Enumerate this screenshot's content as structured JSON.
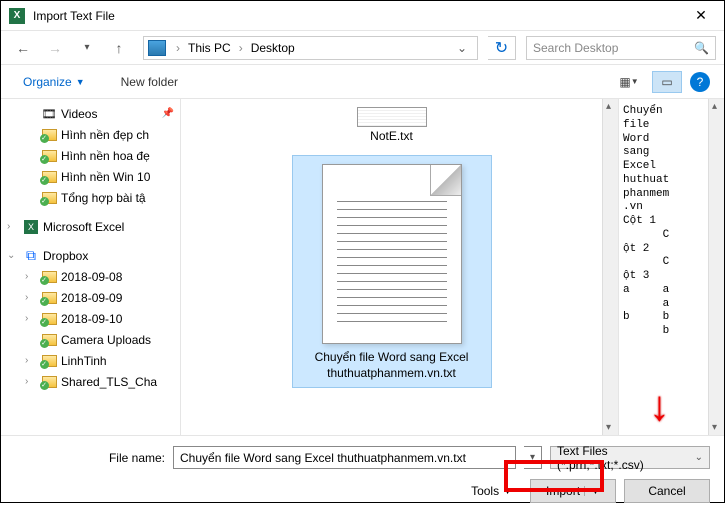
{
  "title": "Import Text File",
  "breadcrumb": {
    "loc1": "This PC",
    "loc2": "Desktop"
  },
  "search": {
    "placeholder": "Search Desktop"
  },
  "toolbar": {
    "organize": "Organize",
    "newfolder": "New folder"
  },
  "tree": {
    "videos": "Videos",
    "hn1": "Hình nền đẹp ch",
    "hn2": "Hình nền hoa đẹ",
    "hn3": "Hình nền Win 10",
    "th": "Tổng hợp bài tậ",
    "excel": "Microsoft Excel",
    "dropbox": "Dropbox",
    "d1": "2018-09-08",
    "d2": "2018-09-09",
    "d3": "2018-09-10",
    "cam": "Camera Uploads",
    "linh": "LinhTinh",
    "shared": "Shared_TLS_Cha"
  },
  "files": {
    "small": "NotE.txt",
    "big_line1": "Chuyển file Word sang Excel",
    "big_line2": "thuthuatphanmem.vn.txt"
  },
  "preview_text": "Chuyển\nfile\nWord\nsang\nExcel\nhuthuat\nphanmem\n.vn\nCột 1\n      C\nột 2\n      C\nột 3\na     a\n      a\nb     b\n      b",
  "footer": {
    "fname_label": "File name:",
    "fname_value": "Chuyển file Word sang Excel thuthuatphanmem.vn.txt",
    "filter": "Text Files (*.prn;*.txt;*.csv)",
    "tools": "Tools",
    "import": "Import",
    "cancel": "Cancel"
  }
}
